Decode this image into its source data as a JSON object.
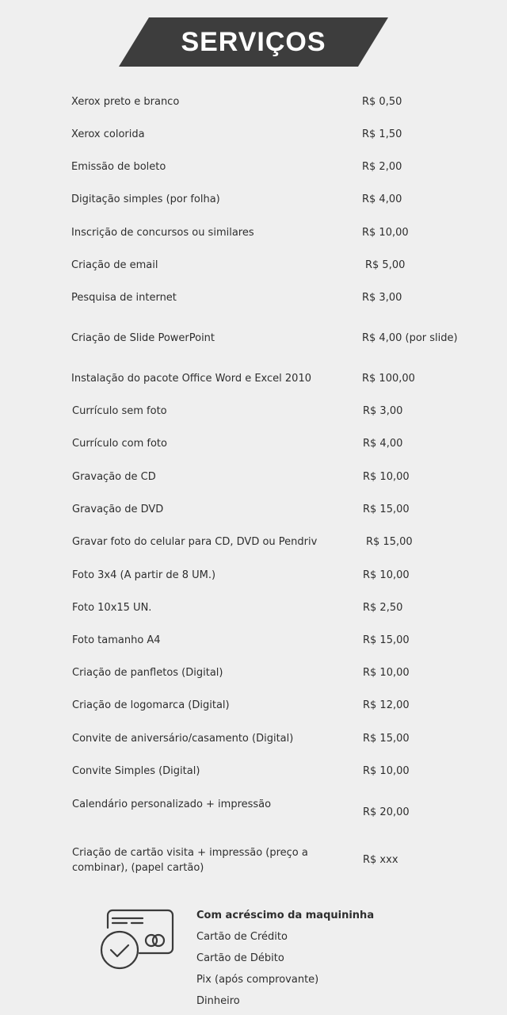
{
  "header": {
    "title": "SERVIÇOS"
  },
  "services": [
    {
      "name": "Xerox preto e branco",
      "price": "R$ 0,50"
    },
    {
      "name": "Xerox colorida",
      "price": "R$ 1,50"
    },
    {
      "name": "Emissão de boleto",
      "price": "R$ 2,00"
    },
    {
      "name": "Digitação simples (por folha)",
      "price": "R$ 4,00"
    },
    {
      "name": "Inscrição de concursos ou similares",
      "price": "R$ 10,00"
    },
    {
      "name": "Criação de email",
      "price": "R$ 5,00"
    },
    {
      "name": "Pesquisa de internet",
      "price": "R$ 3,00"
    },
    {
      "name": "Criação de Slide PowerPoint",
      "price": "R$ 4,00 (por slide)"
    },
    {
      "name": "Instalação do pacote Office Word e Excel 2010",
      "price": "R$ 100,00"
    },
    {
      "name": "Currículo sem foto",
      "price": "R$ 3,00"
    },
    {
      "name": "Currículo com foto",
      "price": "R$ 4,00"
    },
    {
      "name": "Gravação de CD",
      "price": "R$ 10,00"
    },
    {
      "name": "Gravação de DVD",
      "price": "R$ 15,00"
    },
    {
      "name": "Gravar foto do celular para CD, DVD ou Pendriv",
      "price": "R$ 15,00"
    },
    {
      "name": "Foto 3x4 (A partir de 8 UM.)",
      "price": "R$ 10,00"
    },
    {
      "name": "Foto 10x15 UN.",
      "price": "R$ 2,50"
    },
    {
      "name": "Foto tamanho A4",
      "price": "R$ 15,00"
    },
    {
      "name": "Criação de panfletos (Digital)",
      "price": "R$ 10,00"
    },
    {
      "name": "Criação de logomarca (Digital)",
      "price": "R$ 12,00"
    },
    {
      "name": "Convite de aniversário/casamento (Digital)",
      "price": "R$ 15,00"
    },
    {
      "name": "Convite Simples (Digital)",
      "price": "R$ 10,00"
    },
    {
      "name": "Calendário personalizado  + impressão",
      "price": "R$ 20,00"
    },
    {
      "name": "Criação de cartão visita + impressão (preço a combinar), (papel cartão)",
      "price": "R$  xxx"
    }
  ],
  "payments": {
    "heading": "Com acréscimo da maquininha",
    "items": [
      "Cartão de Crédito",
      "Cartão de Débito",
      "Pix (após comprovante)",
      "Dinheiro"
    ],
    "icon": "card-payment-icon"
  },
  "colors": {
    "banner": "#3d3d3d",
    "background": "#efefef",
    "text": "#2e2e2e"
  }
}
